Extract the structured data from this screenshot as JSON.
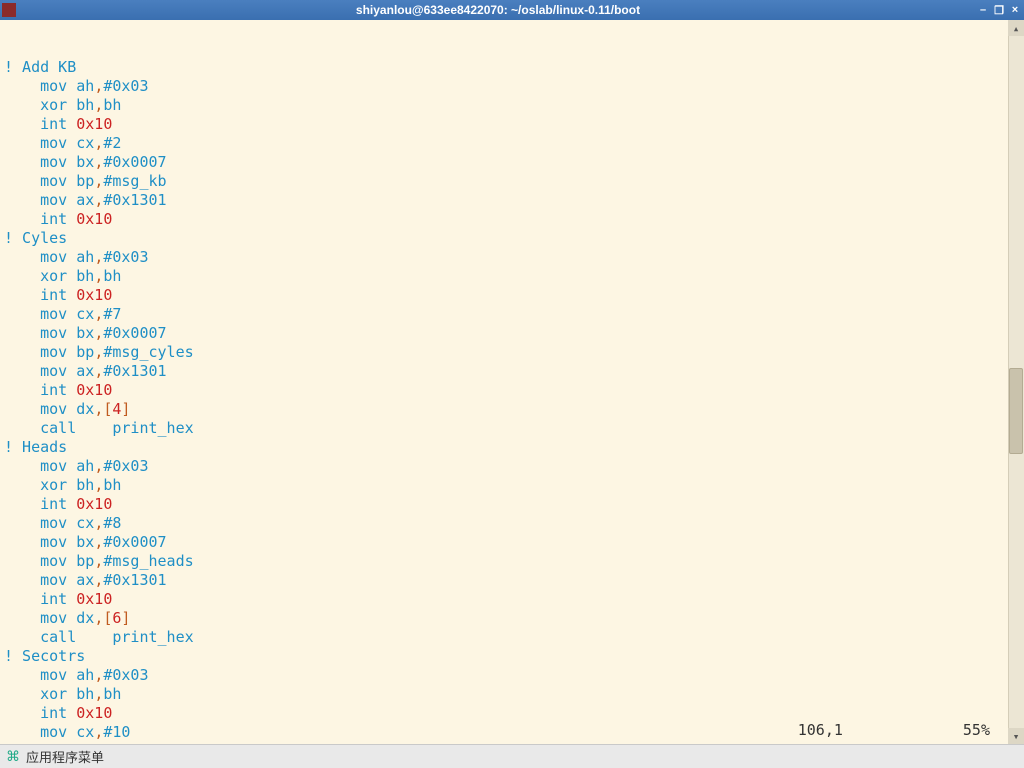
{
  "window": {
    "title": "shiyanlou@633ee8422070: ~/oslab/linux-0.11/boot",
    "buttons": {
      "min": "–",
      "max": "❐",
      "close": "×"
    }
  },
  "status": {
    "pos": "106,1",
    "pct": "55%"
  },
  "taskbar": {
    "menu_label": "应用程序菜单"
  },
  "code": [
    {
      "type": "comment",
      "text": "! Add KB"
    },
    {
      "type": "inst",
      "indent": 1,
      "op": "mov",
      "args": [
        {
          "t": "reg",
          "v": "ah"
        },
        {
          "t": "p",
          "v": ","
        },
        {
          "t": "imm",
          "v": "#0x03"
        }
      ]
    },
    {
      "type": "inst",
      "indent": 1,
      "op": "xor",
      "args": [
        {
          "t": "reg",
          "v": "bh"
        },
        {
          "t": "p",
          "v": ","
        },
        {
          "t": "reg",
          "v": "bh"
        }
      ]
    },
    {
      "type": "inst",
      "indent": 1,
      "op": "int",
      "args": [
        {
          "t": "lit",
          "v": "0x10"
        }
      ]
    },
    {
      "type": "inst",
      "indent": 1,
      "op": "mov",
      "args": [
        {
          "t": "reg",
          "v": "cx"
        },
        {
          "t": "p",
          "v": ","
        },
        {
          "t": "imm",
          "v": "#2"
        }
      ]
    },
    {
      "type": "inst",
      "indent": 1,
      "op": "mov",
      "args": [
        {
          "t": "reg",
          "v": "bx"
        },
        {
          "t": "p",
          "v": ","
        },
        {
          "t": "imm",
          "v": "#0x0007"
        }
      ]
    },
    {
      "type": "inst",
      "indent": 1,
      "op": "mov",
      "args": [
        {
          "t": "reg",
          "v": "bp"
        },
        {
          "t": "p",
          "v": ","
        },
        {
          "t": "imm",
          "v": "#msg_kb"
        }
      ]
    },
    {
      "type": "inst",
      "indent": 1,
      "op": "mov",
      "args": [
        {
          "t": "reg",
          "v": "ax"
        },
        {
          "t": "p",
          "v": ","
        },
        {
          "t": "imm",
          "v": "#0x1301"
        }
      ]
    },
    {
      "type": "inst",
      "indent": 1,
      "op": "int",
      "args": [
        {
          "t": "lit",
          "v": "0x10"
        }
      ]
    },
    {
      "type": "comment",
      "text": "! Cyles"
    },
    {
      "type": "inst",
      "indent": 1,
      "op": "mov",
      "args": [
        {
          "t": "reg",
          "v": "ah"
        },
        {
          "t": "p",
          "v": ","
        },
        {
          "t": "imm",
          "v": "#0x03"
        }
      ]
    },
    {
      "type": "inst",
      "indent": 1,
      "op": "xor",
      "args": [
        {
          "t": "reg",
          "v": "bh"
        },
        {
          "t": "p",
          "v": ","
        },
        {
          "t": "reg",
          "v": "bh"
        }
      ]
    },
    {
      "type": "inst",
      "indent": 1,
      "op": "int",
      "args": [
        {
          "t": "lit",
          "v": "0x10"
        }
      ]
    },
    {
      "type": "inst",
      "indent": 1,
      "op": "mov",
      "args": [
        {
          "t": "reg",
          "v": "cx"
        },
        {
          "t": "p",
          "v": ","
        },
        {
          "t": "imm",
          "v": "#7"
        }
      ]
    },
    {
      "type": "inst",
      "indent": 1,
      "op": "mov",
      "args": [
        {
          "t": "reg",
          "v": "bx"
        },
        {
          "t": "p",
          "v": ","
        },
        {
          "t": "imm",
          "v": "#0x0007"
        }
      ]
    },
    {
      "type": "inst",
      "indent": 1,
      "op": "mov",
      "args": [
        {
          "t": "reg",
          "v": "bp"
        },
        {
          "t": "p",
          "v": ","
        },
        {
          "t": "imm",
          "v": "#msg_cyles"
        }
      ]
    },
    {
      "type": "inst",
      "indent": 1,
      "op": "mov",
      "args": [
        {
          "t": "reg",
          "v": "ax"
        },
        {
          "t": "p",
          "v": ","
        },
        {
          "t": "imm",
          "v": "#0x1301"
        }
      ]
    },
    {
      "type": "inst",
      "indent": 1,
      "op": "int",
      "args": [
        {
          "t": "lit",
          "v": "0x10"
        }
      ]
    },
    {
      "type": "inst",
      "indent": 1,
      "op": "mov",
      "args": [
        {
          "t": "reg",
          "v": "dx"
        },
        {
          "t": "p",
          "v": ","
        },
        {
          "t": "p",
          "v": "["
        },
        {
          "t": "lit",
          "v": "4"
        },
        {
          "t": "p",
          "v": "]"
        }
      ]
    },
    {
      "type": "inst",
      "indent": 1,
      "op": "call",
      "pad": "    ",
      "args": [
        {
          "t": "ident",
          "v": "print_hex"
        }
      ]
    },
    {
      "type": "comment",
      "text": "! Heads"
    },
    {
      "type": "inst",
      "indent": 1,
      "op": "mov",
      "args": [
        {
          "t": "reg",
          "v": "ah"
        },
        {
          "t": "p",
          "v": ","
        },
        {
          "t": "imm",
          "v": "#0x03"
        }
      ]
    },
    {
      "type": "inst",
      "indent": 1,
      "op": "xor",
      "args": [
        {
          "t": "reg",
          "v": "bh"
        },
        {
          "t": "p",
          "v": ","
        },
        {
          "t": "reg",
          "v": "bh"
        }
      ]
    },
    {
      "type": "inst",
      "indent": 1,
      "op": "int",
      "args": [
        {
          "t": "lit",
          "v": "0x10"
        }
      ]
    },
    {
      "type": "inst",
      "indent": 1,
      "op": "mov",
      "args": [
        {
          "t": "reg",
          "v": "cx"
        },
        {
          "t": "p",
          "v": ","
        },
        {
          "t": "imm",
          "v": "#8"
        }
      ]
    },
    {
      "type": "inst",
      "indent": 1,
      "op": "mov",
      "args": [
        {
          "t": "reg",
          "v": "bx"
        },
        {
          "t": "p",
          "v": ","
        },
        {
          "t": "imm",
          "v": "#0x0007"
        }
      ]
    },
    {
      "type": "inst",
      "indent": 1,
      "op": "mov",
      "args": [
        {
          "t": "reg",
          "v": "bp"
        },
        {
          "t": "p",
          "v": ","
        },
        {
          "t": "imm",
          "v": "#msg_heads"
        }
      ]
    },
    {
      "type": "inst",
      "indent": 1,
      "op": "mov",
      "args": [
        {
          "t": "reg",
          "v": "ax"
        },
        {
          "t": "p",
          "v": ","
        },
        {
          "t": "imm",
          "v": "#0x1301"
        }
      ]
    },
    {
      "type": "inst",
      "indent": 1,
      "op": "int",
      "args": [
        {
          "t": "lit",
          "v": "0x10"
        }
      ]
    },
    {
      "type": "inst",
      "indent": 1,
      "op": "mov",
      "args": [
        {
          "t": "reg",
          "v": "dx"
        },
        {
          "t": "p",
          "v": ","
        },
        {
          "t": "p",
          "v": "["
        },
        {
          "t": "lit",
          "v": "6"
        },
        {
          "t": "p",
          "v": "]"
        }
      ]
    },
    {
      "type": "inst",
      "indent": 1,
      "op": "call",
      "pad": "    ",
      "args": [
        {
          "t": "ident",
          "v": "print_hex"
        }
      ]
    },
    {
      "type": "comment",
      "text": "! Secotrs"
    },
    {
      "type": "inst",
      "indent": 1,
      "op": "mov",
      "args": [
        {
          "t": "reg",
          "v": "ah"
        },
        {
          "t": "p",
          "v": ","
        },
        {
          "t": "imm",
          "v": "#0x03"
        }
      ]
    },
    {
      "type": "inst",
      "indent": 1,
      "op": "xor",
      "args": [
        {
          "t": "reg",
          "v": "bh"
        },
        {
          "t": "p",
          "v": ","
        },
        {
          "t": "reg",
          "v": "bh"
        }
      ]
    },
    {
      "type": "inst",
      "indent": 1,
      "op": "int",
      "args": [
        {
          "t": "lit",
          "v": "0x10"
        }
      ]
    },
    {
      "type": "inst",
      "indent": 1,
      "op": "mov",
      "args": [
        {
          "t": "reg",
          "v": "cx"
        },
        {
          "t": "p",
          "v": ","
        },
        {
          "t": "imm",
          "v": "#10"
        }
      ]
    }
  ],
  "scroll": {
    "thumb_top_pct": 48,
    "thumb_height_pct": 12
  }
}
